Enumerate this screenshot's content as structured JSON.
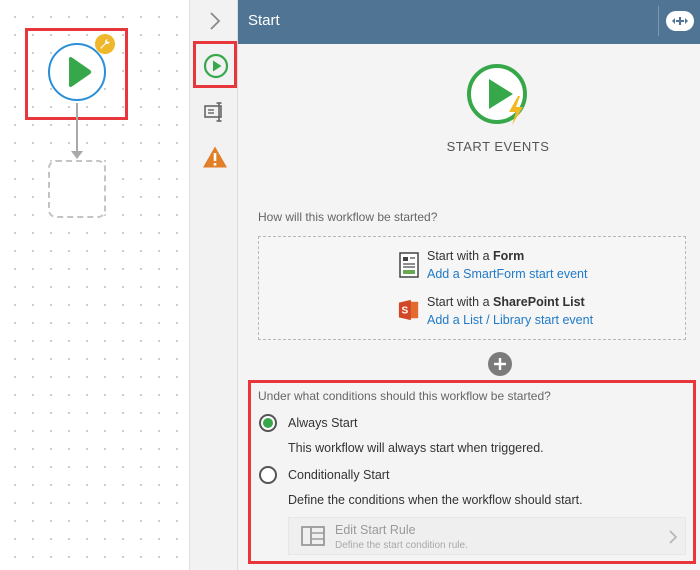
{
  "panel": {
    "title": "Start",
    "start_events_title": "START EVENTS",
    "question_start": "How will this workflow be started?",
    "options": [
      {
        "title_prefix": "Start with a ",
        "title_bold": "Form",
        "link": "Add a SmartForm start event",
        "icon": "form-icon"
      },
      {
        "title_prefix": "Start with a ",
        "title_bold": "SharePoint List",
        "link": "Add a List / Library start event",
        "icon": "sharepoint-icon"
      }
    ],
    "question_conditions": "Under what conditions should this workflow be started?",
    "conditions": [
      {
        "label": "Always Start",
        "description": "This workflow will always start when triggered.",
        "checked": true
      },
      {
        "label": "Conditionally Start",
        "description": "Define the conditions when the workflow should start.",
        "checked": false
      }
    ],
    "rule": {
      "title": "Edit Start Rule",
      "subtitle": "Define the start condition rule."
    }
  },
  "colors": {
    "header": "#4f7494",
    "play_green": "#37a84a",
    "link_blue": "#1f7ac7",
    "highlight_red": "#e8363d",
    "badge_yellow": "#f1b72b"
  }
}
